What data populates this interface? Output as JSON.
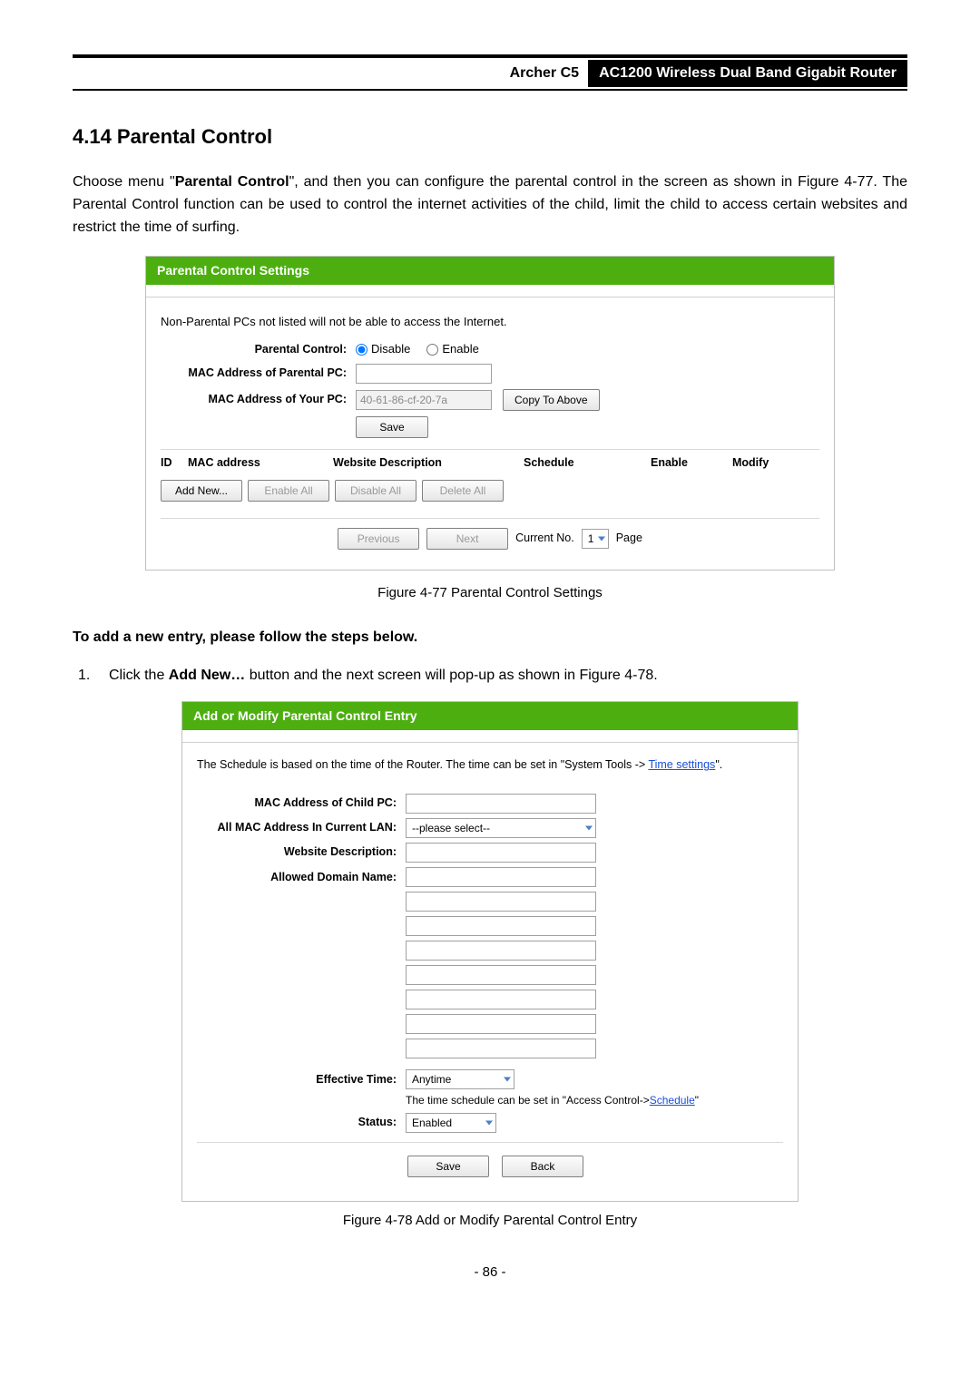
{
  "header": {
    "model": "Archer C5",
    "product": "AC1200 Wireless Dual Band Gigabit Router"
  },
  "section": {
    "heading": "4.14  Parental Control",
    "intro_prefix": "Choose menu \"",
    "intro_bold": "Parental Control",
    "intro_suffix": "\", and then you can configure the parental control in the screen as shown in Figure 4-77. The Parental Control function can be used to control the internet activities of the child, limit the child to access certain websites and restrict the time of surfing."
  },
  "fig1": {
    "title": "Parental Control Settings",
    "note": "Non-Parental PCs not listed will not be able to access the Internet.",
    "labels": {
      "parental_control": "Parental Control:",
      "mac_parental": "MAC Address of Parental PC:",
      "mac_your": "MAC Address of Your PC:"
    },
    "radio_disable": "Disable",
    "radio_enable": "Enable",
    "mac_your_value": "40-61-86-cf-20-7a",
    "btn_copy": "Copy To Above",
    "btn_save": "Save",
    "table_headers": {
      "id": "ID",
      "mac": "MAC address",
      "website": "Website Description",
      "schedule": "Schedule",
      "enable": "Enable",
      "modify": "Modify"
    },
    "btns": {
      "add_new": "Add New...",
      "enable_all": "Enable All",
      "disable_all": "Disable All",
      "delete_all": "Delete All"
    },
    "pager": {
      "previous": "Previous",
      "next": "Next",
      "current_no": "Current No.",
      "page": "Page",
      "value": "1"
    },
    "caption": "Figure 4-77 Parental Control Settings"
  },
  "steps": {
    "subheading": "To add a new entry, please follow the steps below.",
    "s1_num": "1.",
    "s1_a": "Click the ",
    "s1_b": "Add New…",
    "s1_c": " button and the next screen will pop-up as shown in Figure 4-78."
  },
  "fig2": {
    "title": "Add or Modify Parental Control Entry",
    "schedule_note_a": "The Schedule is based on the time of the Router. The time can be set in \"System Tools -> ",
    "schedule_note_link": "Time settings",
    "schedule_note_b": "\".",
    "labels": {
      "mac_child": "MAC Address of Child PC:",
      "all_mac": "All MAC Address In Current LAN:",
      "website": "Website Description:",
      "allowed": "Allowed Domain Name:",
      "effective": "Effective Time:",
      "status": "Status:"
    },
    "all_mac_value": "--please select--",
    "effective_value": "Anytime",
    "effective_hint_a": "The time schedule can be set in \"Access Control->",
    "effective_hint_link": "Schedule",
    "effective_hint_b": "\"",
    "status_value": "Enabled",
    "btn_save": "Save",
    "btn_back": "Back",
    "caption": "Figure 4-78 Add or Modify Parental Control Entry"
  },
  "page_number": "- 86 -"
}
